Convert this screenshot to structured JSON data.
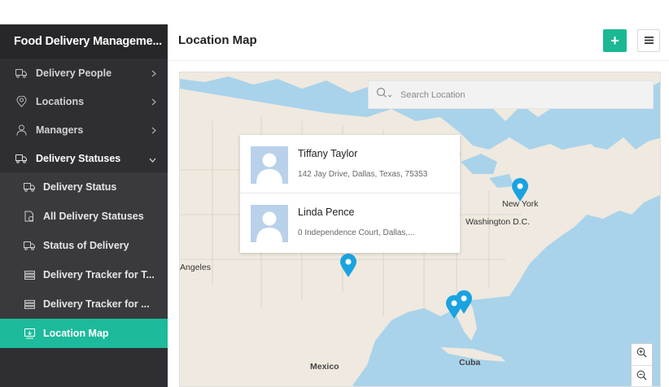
{
  "app": {
    "title": "Food Delivery Manageme..."
  },
  "sidebar": {
    "items": [
      {
        "label": "Delivery People",
        "icon": "truck-icon"
      },
      {
        "label": "Locations",
        "icon": "location-pin-icon"
      },
      {
        "label": "Managers",
        "icon": "user-icon"
      },
      {
        "label": "Delivery Statuses",
        "icon": "truck-icon",
        "expanded": true
      }
    ],
    "subitems": [
      {
        "label": "Delivery Status",
        "icon": "truck-icon"
      },
      {
        "label": "All Delivery Statuses",
        "icon": "document-icon"
      },
      {
        "label": "Status of Delivery",
        "icon": "truck-icon"
      },
      {
        "label": "Delivery Tracker for T...",
        "icon": "list-icon"
      },
      {
        "label": "Delivery Tracker for ...",
        "icon": "list-icon"
      },
      {
        "label": "Location Map",
        "icon": "map-marker-icon",
        "active": true
      }
    ]
  },
  "header": {
    "title": "Location Map",
    "add_label": "+"
  },
  "search": {
    "placeholder": "Search Location"
  },
  "popup": {
    "people": [
      {
        "name": "Tiffany Taylor",
        "address": "142 Jay Drive, Dallas, Texas, 75353"
      },
      {
        "name": "Linda Pence",
        "address": "0 Independence Court, Dallas,..."
      }
    ]
  },
  "map": {
    "labels": {
      "new_york": "New York",
      "washington": "Washington D.C.",
      "angeles": "Angeles",
      "mexico": "Mexico",
      "cuba": "Cuba"
    }
  },
  "colors": {
    "accent": "#1dbb9b",
    "sidebar_bg": "#2f2f33",
    "pin": "#1aa3e0",
    "water": "#a9d3ea",
    "land": "#efe9df"
  }
}
